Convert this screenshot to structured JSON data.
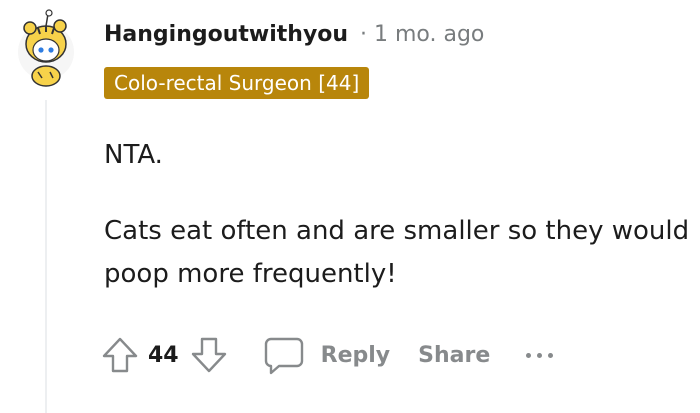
{
  "comment": {
    "username": "Hangingoutwithyou",
    "separator": "·",
    "timestamp": "1 mo. ago",
    "flair": "Colo-rectal Surgeon [44]",
    "flair_color": "#b8860b",
    "body": [
      "NTA.",
      "Cats eat often and are smaller so they would poop more frequently!"
    ]
  },
  "actions": {
    "upvote_icon": "arrow-up-icon",
    "vote_count": "44",
    "downvote_icon": "arrow-down-icon",
    "comment_icon": "speech-bubble-icon",
    "reply_label": "Reply",
    "share_label": "Share",
    "more_icon": "ellipsis-icon"
  },
  "colors": {
    "text": "#1c1c1c",
    "muted": "#878a8c",
    "thread_line": "#edeff1"
  }
}
